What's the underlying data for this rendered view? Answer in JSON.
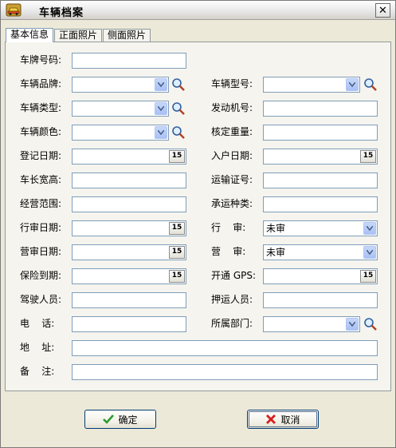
{
  "window": {
    "title": "车辆档案",
    "close_glyph": "✕",
    "app_icon": "car-icon"
  },
  "tabs": [
    {
      "label": "基本信息",
      "active": true
    },
    {
      "label": "正面照片",
      "active": false
    },
    {
      "label": "侧面照片",
      "active": false
    }
  ],
  "form": {
    "plate_no": {
      "label": "车牌号码:",
      "value": ""
    },
    "brand": {
      "label": "车辆品牌:",
      "value": ""
    },
    "model": {
      "label": "车辆型号:",
      "value": ""
    },
    "vehicle_type": {
      "label": "车辆类型:",
      "value": ""
    },
    "engine_no": {
      "label": "发动机号:",
      "value": ""
    },
    "color": {
      "label": "车辆颜色:",
      "value": ""
    },
    "rated_weight": {
      "label": "核定重量:",
      "value": ""
    },
    "reg_date": {
      "label": "登记日期:",
      "value": ""
    },
    "entry_date": {
      "label": "入户日期:",
      "value": ""
    },
    "dimensions": {
      "label": "车长宽高:",
      "value": ""
    },
    "transport_cert": {
      "label": "运输证号:",
      "value": ""
    },
    "biz_scope": {
      "label": "经营范围:",
      "value": ""
    },
    "cargo_type": {
      "label": "承运种类:",
      "value": ""
    },
    "drive_audit_date": {
      "label": "行审日期:",
      "value": ""
    },
    "drive_audit": {
      "label": "行    审:",
      "value": "未审"
    },
    "biz_audit_date": {
      "label": "营审日期:",
      "value": ""
    },
    "biz_audit": {
      "label": "营    审:",
      "value": "未审"
    },
    "insurance_exp": {
      "label": "保险到期:",
      "value": ""
    },
    "gps_open": {
      "label": "开通 GPS:",
      "value": ""
    },
    "driver": {
      "label": "驾驶人员:",
      "value": ""
    },
    "escort": {
      "label": "押运人员:",
      "value": ""
    },
    "phone": {
      "label": "电    话:",
      "value": ""
    },
    "department": {
      "label": "所属部门:",
      "value": ""
    },
    "address": {
      "label": "地    址:",
      "value": ""
    },
    "remark": {
      "label": "备    注:",
      "value": ""
    }
  },
  "calendar_glyph": "15",
  "buttons": {
    "ok_label": "确定",
    "cancel_label": "取消"
  },
  "colors": {
    "window_bg": "#ECE9D8",
    "field_border": "#7F9DB9",
    "button_border": "#003C74",
    "ok_icon": "#2E9B2E",
    "cancel_icon": "#D81E1E"
  }
}
